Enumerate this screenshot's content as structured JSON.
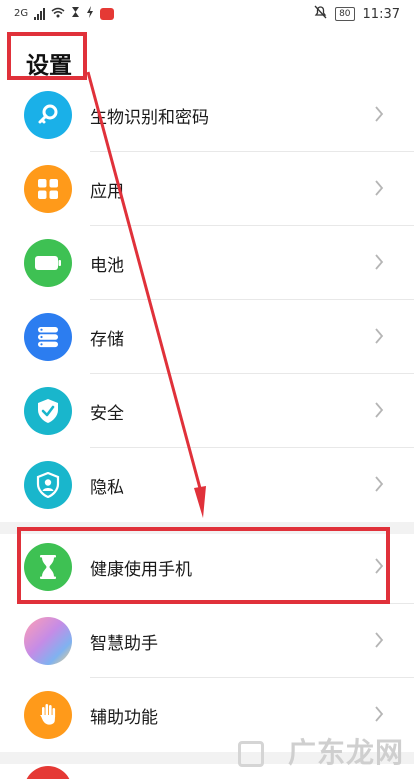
{
  "status_bar": {
    "network": "2G",
    "time": "11:37",
    "battery": "80"
  },
  "page": {
    "title": "设置"
  },
  "items": [
    {
      "label": "生物识别和密码",
      "icon": "key-icon",
      "color": "#1ab0e8"
    },
    {
      "label": "应用",
      "icon": "apps-grid-icon",
      "color": "#ff9a1a"
    },
    {
      "label": "电池",
      "icon": "battery-icon",
      "color": "#3ec153"
    },
    {
      "label": "存储",
      "icon": "storage-icon",
      "color": "#2c7df0"
    },
    {
      "label": "安全",
      "icon": "shield-check-icon",
      "color": "#19b6cc"
    },
    {
      "label": "隐私",
      "icon": "privacy-icon",
      "color": "#19b6cc"
    },
    {
      "label": "健康使用手机",
      "icon": "hourglass-icon",
      "color": "#3ec153"
    },
    {
      "label": "智慧助手",
      "icon": "assistant-icon",
      "color": "#c58ce6"
    },
    {
      "label": "辅助功能",
      "icon": "hand-icon",
      "color": "#ff9a1a"
    }
  ],
  "watermark": {
    "text": "广东龙网"
  },
  "colors": {
    "highlight": "#e0313a"
  }
}
